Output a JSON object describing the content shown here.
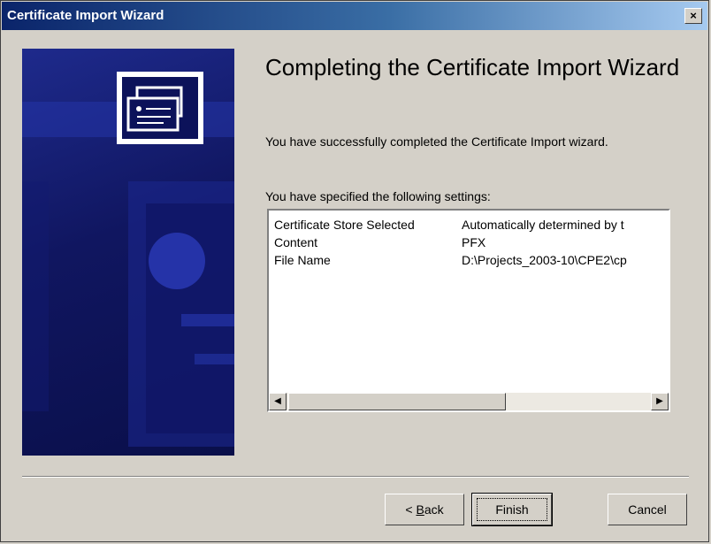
{
  "window": {
    "title": "Certificate Import Wizard",
    "close_label": "×"
  },
  "main": {
    "heading": "Completing the Certificate Import Wizard",
    "message": "You have successfully completed the Certificate Import wizard.",
    "settings_label": "You have specified the following settings:"
  },
  "settings": [
    {
      "name": "Certificate Store Selected",
      "value": "Automatically determined by t"
    },
    {
      "name": "Content",
      "value": "PFX"
    },
    {
      "name": "File Name",
      "value": "D:\\Projects_2003-10\\CPE2\\cp"
    }
  ],
  "scrollbar": {
    "left_arrow": "◀",
    "right_arrow": "▶"
  },
  "buttons": {
    "back_mnemonic": "B",
    "back_rest": "ack",
    "back_prefix": "< ",
    "finish": "Finish",
    "cancel": "Cancel"
  },
  "colors": {
    "title_gradient_start": "#0a246a",
    "title_gradient_end": "#a6caf0",
    "banner": "#101660",
    "face": "#d4d0c8"
  }
}
